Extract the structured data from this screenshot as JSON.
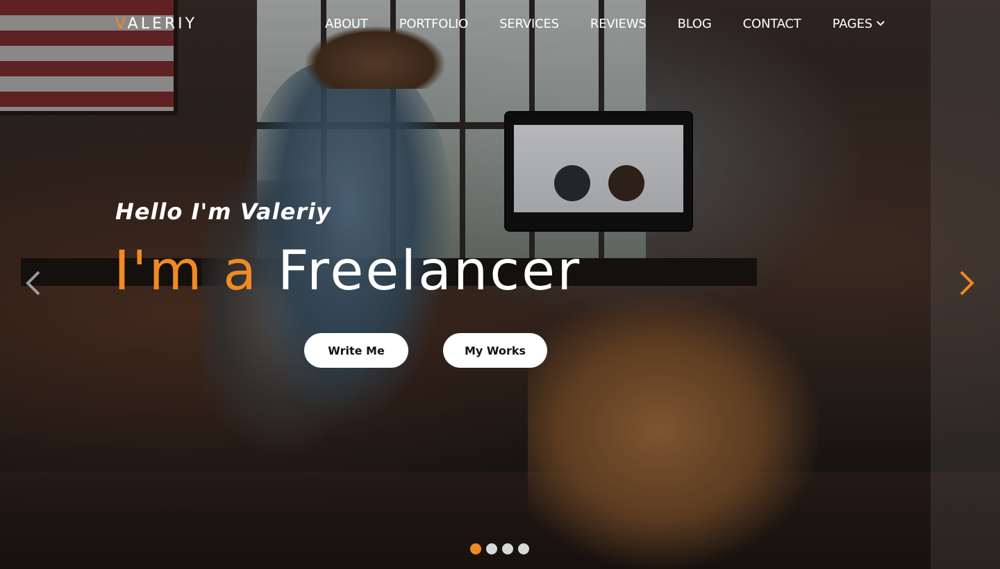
{
  "brand": {
    "logo_first_letter": "V",
    "logo_rest": "ALERIY"
  },
  "nav": {
    "items": [
      {
        "label": "ABOUT"
      },
      {
        "label": "PORTFOLIO"
      },
      {
        "label": "SERVICES"
      },
      {
        "label": "REVIEWS"
      },
      {
        "label": "BLOG"
      },
      {
        "label": "CONTACT"
      },
      {
        "label": "PAGES",
        "has_dropdown": true
      }
    ],
    "dropdown_icon": "chevron-down-icon"
  },
  "hero": {
    "greeting": "Hello I'm Valeriy",
    "headline_prefix": "I'm a",
    "headline_word": "Freelancer",
    "buttons": {
      "primary": "Write Me",
      "secondary": "My Works"
    }
  },
  "carousel": {
    "prev_icon": "chevron-left-icon",
    "next_icon": "chevron-right-icon",
    "slide_count": 4,
    "active_slide": 1
  },
  "colors": {
    "accent": "#f08a24",
    "text": "#ffffff",
    "button_bg": "#ffffff",
    "dot_inactive": "#d9d9d9"
  }
}
